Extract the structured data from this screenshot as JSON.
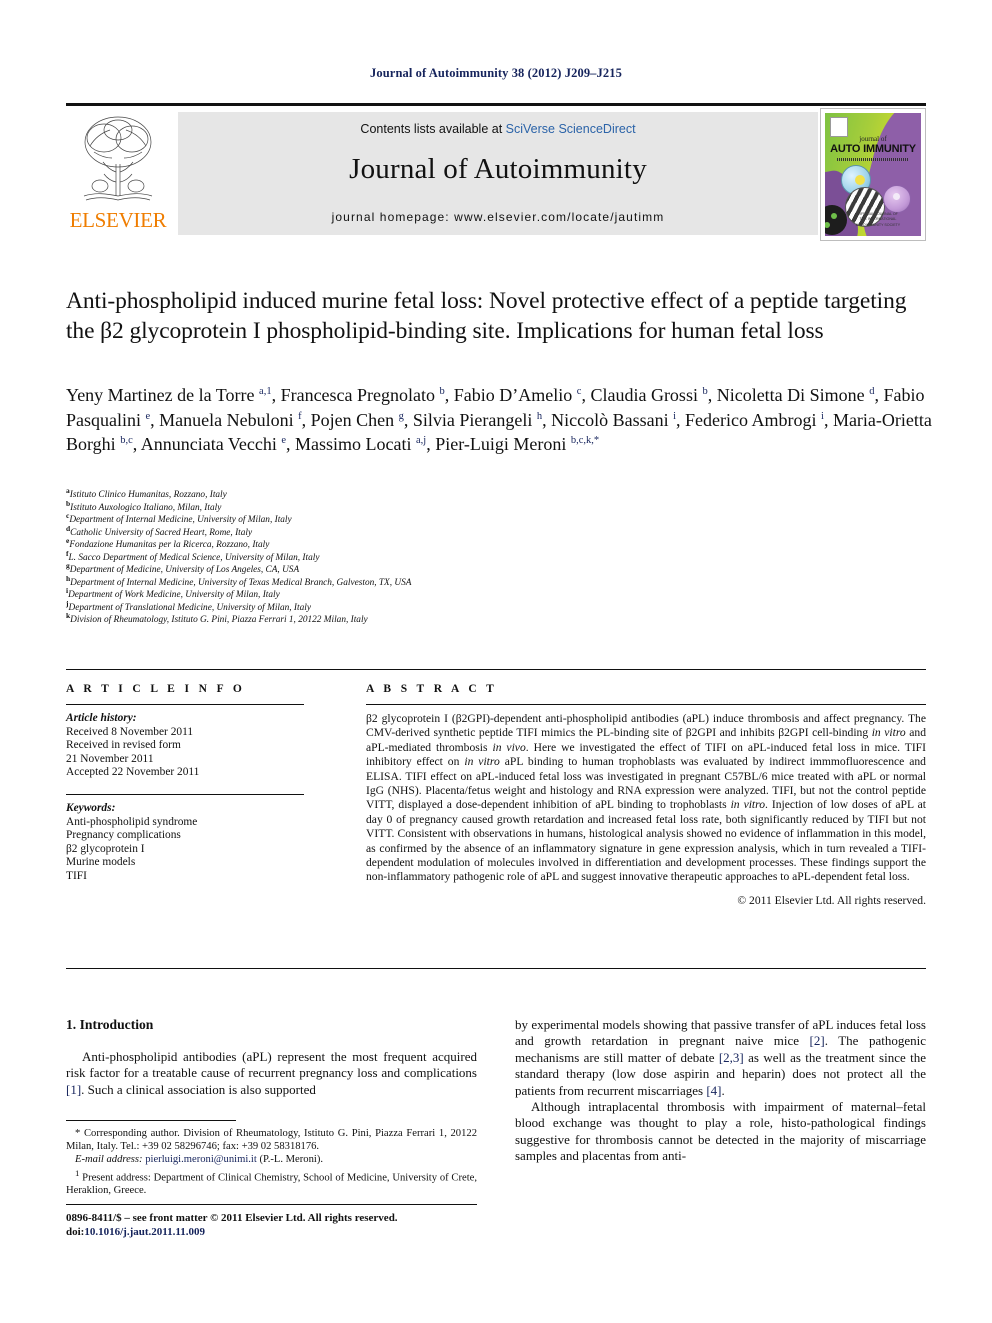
{
  "running_head": "Journal of Autoimmunity 38 (2012) J209–J215",
  "masthead": {
    "contents_prefix": "Contents lists available at ",
    "sciencedirect": "SciVerse ScienceDirect",
    "journal_title": "Journal of Autoimmunity",
    "homepage": "journal homepage: www.elsevier.com/locate/jautimm",
    "publisher_wordmark": "ELSEVIER",
    "cover": {
      "small_title": "journal of",
      "big_title": "AUTO IMMUNITY",
      "foot_text": "OFFICIAL JOURNAL OF\nTHE INTERNATIONAL\nAUTOIMMUNITY SOCIETY"
    },
    "accent_link_color": "#2b63a8",
    "elsevier_orange": "#ef7d00"
  },
  "article": {
    "title": "Anti-phospholipid induced murine fetal loss: Novel protective effect of a peptide targeting the β2 glycoprotein I phospholipid-binding site. Implications for human fetal loss",
    "authors_html": "Yeny Martinez de la Torre <sup>a,1</sup>, Francesca Pregnolato <sup>b</sup>, Fabio D&rsquo;Amelio <sup>c</sup>, Claudia Grossi <sup>b</sup>, Nicoletta Di Simone <sup>d</sup>, Fabio Pasqualini <sup>e</sup>, Manuela Nebuloni <sup>f</sup>, Pojen Chen <sup>g</sup>, Silvia Pierangeli <sup>h</sup>, Niccol&ograve; Bassani <sup>i</sup>, Federico Ambrogi <sup>i</sup>, Maria-Orietta Borghi <sup>b,c</sup>, Annunciata Vecchi <sup>e</sup>, Massimo Locati <sup>a,j</sup>, Pier-Luigi Meroni <sup>b,c,k,</sup><sup>*</sup>",
    "affiliations": [
      {
        "label": "a",
        "text": "Istituto Clinico Humanitas, Rozzano, Italy"
      },
      {
        "label": "b",
        "text": "Istituto Auxologico Italiano, Milan, Italy"
      },
      {
        "label": "c",
        "text": "Department of Internal Medicine, University of Milan, Italy"
      },
      {
        "label": "d",
        "text": "Catholic University of Sacred Heart, Rome, Italy"
      },
      {
        "label": "e",
        "text": "Fondazione Humanitas per la Ricerca, Rozzano, Italy"
      },
      {
        "label": "f",
        "text": "L. Sacco Department of Medical Science, University of Milan, Italy"
      },
      {
        "label": "g",
        "text": "Department of Medicine, University of Los Angeles, CA, USA"
      },
      {
        "label": "h",
        "text": "Department of Internal Medicine, University of Texas Medical Branch, Galveston, TX, USA"
      },
      {
        "label": "i",
        "text": "Department of Work Medicine, University of Milan, Italy"
      },
      {
        "label": "j",
        "text": "Department of Translational Medicine, University of Milan, Italy"
      },
      {
        "label": "k",
        "text": "Division of Rheumatology, Istituto G. Pini, Piazza Ferrari 1, 20122 Milan, Italy"
      }
    ]
  },
  "article_info": {
    "heading": "A R T I C L E   I N F O",
    "history_label": "Article history:",
    "history": [
      "Received 8 November 2011",
      "Received in revised form",
      "21 November 2011",
      "Accepted 22 November 2011"
    ],
    "keywords_label": "Keywords:",
    "keywords": [
      "Anti-phospholipid syndrome",
      "Pregnancy complications",
      "β2 glycoprotein I",
      "Murine models",
      "TIFI"
    ]
  },
  "abstract": {
    "heading": "A B S T R A C T",
    "text_html": "&beta;2 glycoprotein I (&beta;2GPI)-dependent anti-phospholipid antibodies (aPL) induce thrombosis and affect pregnancy. The CMV-derived synthetic peptide TIFI mimics the PL-binding site of &beta;2GPI and inhibits &beta;2GPI cell-binding <em>in vitro</em> and aPL-mediated thrombosis <em>in vivo</em>. Here we investigated the effect of TIFI on aPL-induced fetal loss in mice. TIFI inhibitory effect on <em>in vitro</em> aPL binding to human trophoblasts was evaluated by indirect immmofluorescence and ELISA. TIFI effect on aPL-induced fetal loss was investigated in pregnant C57BL/6 mice treated with aPL or normal IgG (NHS). Placenta/fetus weight and histology and RNA expression were analyzed. TIFI, but not the control peptide VITT, displayed a dose-dependent inhibition of aPL binding to trophoblasts <em>in vitro</em>. Injection of low doses of aPL at day 0 of pregnancy caused growth retardation and increased fetal loss rate, both significantly reduced by TIFI but not VITT. Consistent with observations in humans, histological analysis showed no evidence of inflammation in this model, as confirmed by the absence of an inflammatory signature in gene expression analysis, which in turn revealed a TIFI-dependent modulation of molecules involved in differentiation and development processes. These findings support the non-inflammatory pathogenic role of aPL and suggest innovative therapeutic approaches to aPL-dependent fetal loss.",
    "copyright": "© 2011 Elsevier Ltd. All rights reserved."
  },
  "body": {
    "section_heading": "1.  Introduction",
    "left_paragraph_html": "Anti-phospholipid antibodies (aPL) represent the most frequent acquired risk factor for a treatable cause of recurrent pregnancy loss and complications <span class=\"ref\">[1]</span>. Such a clinical association is also supported",
    "right_paragraph_1_html": "by experimental models showing that passive transfer of aPL induces fetal loss and growth retardation in pregnant naive mice <span class=\"ref\">[2]</span>. The pathogenic mechanisms are still matter of debate <span class=\"ref\">[2,3]</span> as well as the treatment since the standard therapy (low dose aspirin and heparin) does not protect all the patients from recurrent miscarriages <span class=\"ref\">[4]</span>.",
    "right_paragraph_2_html": "Although intraplacental thrombosis with impairment of maternal&ndash;fetal blood exchange was thought to play a role, histo-pathological findings suggestive for thrombosis cannot be detected in the majority of miscarriage samples and placentas from anti-"
  },
  "footnotes": {
    "corresponding_html": "* Corresponding author. Division of Rheumatology, Istituto G. Pini, Piazza Ferrari 1, 20122 Milan, Italy. Tel.: +39 02 58296746; fax: +39 02 58318176.",
    "email_label": "E-mail address:",
    "email": "pierluigi.meroni@unimi.it",
    "email_suffix": "(P.-L. Meroni).",
    "present_address_html": "<sup>1</sup> Present address: Department of Clinical Chemistry, School of Medicine, University of Crete, Heraklion, Greece."
  },
  "colophon": {
    "issn_line": "0896-8411/$ – see front matter © 2011 Elsevier Ltd. All rights reserved.",
    "doi_prefix": "doi:",
    "doi": "10.1016/j.jaut.2011.11.009"
  }
}
